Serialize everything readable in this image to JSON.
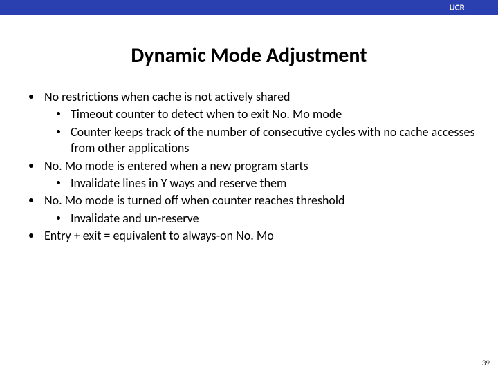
{
  "header": {
    "label": "UCR"
  },
  "title": "Dynamic Mode Adjustment",
  "bullets": [
    {
      "text": "No restrictions when cache is not actively shared",
      "sub": [
        "Timeout counter to detect when to exit No. Mo mode",
        "Counter keeps track of the number of consecutive cycles with no cache accesses from other applications"
      ]
    },
    {
      "text": "No. Mo mode is entered when a new program starts",
      "sub": [
        "Invalidate lines in Y ways and reserve them"
      ]
    },
    {
      "text": "No. Mo mode is turned off when counter reaches threshold",
      "sub": [
        "Invalidate and un-reserve"
      ]
    },
    {
      "text": "Entry + exit = equivalent to always-on No. Mo",
      "sub": []
    }
  ],
  "page_number": "39"
}
